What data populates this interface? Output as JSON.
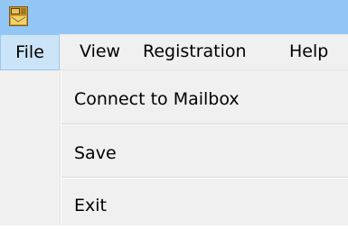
{
  "window": {
    "icon": "mail-app-icon"
  },
  "menubar": {
    "items": [
      {
        "label": "File",
        "active": true
      },
      {
        "label": "View"
      },
      {
        "label": "Registration"
      },
      {
        "label": "Help"
      }
    ]
  },
  "file_menu": {
    "items": [
      {
        "label": "Connect to Mailbox"
      },
      {
        "label": "Save"
      },
      {
        "label": "Exit"
      }
    ]
  },
  "colors": {
    "titlebar": "#94c6f5",
    "menu_active_bg": "#cce4f7",
    "menu_active_border": "#99c9ef",
    "menu_bg": "#f0f0f0"
  }
}
